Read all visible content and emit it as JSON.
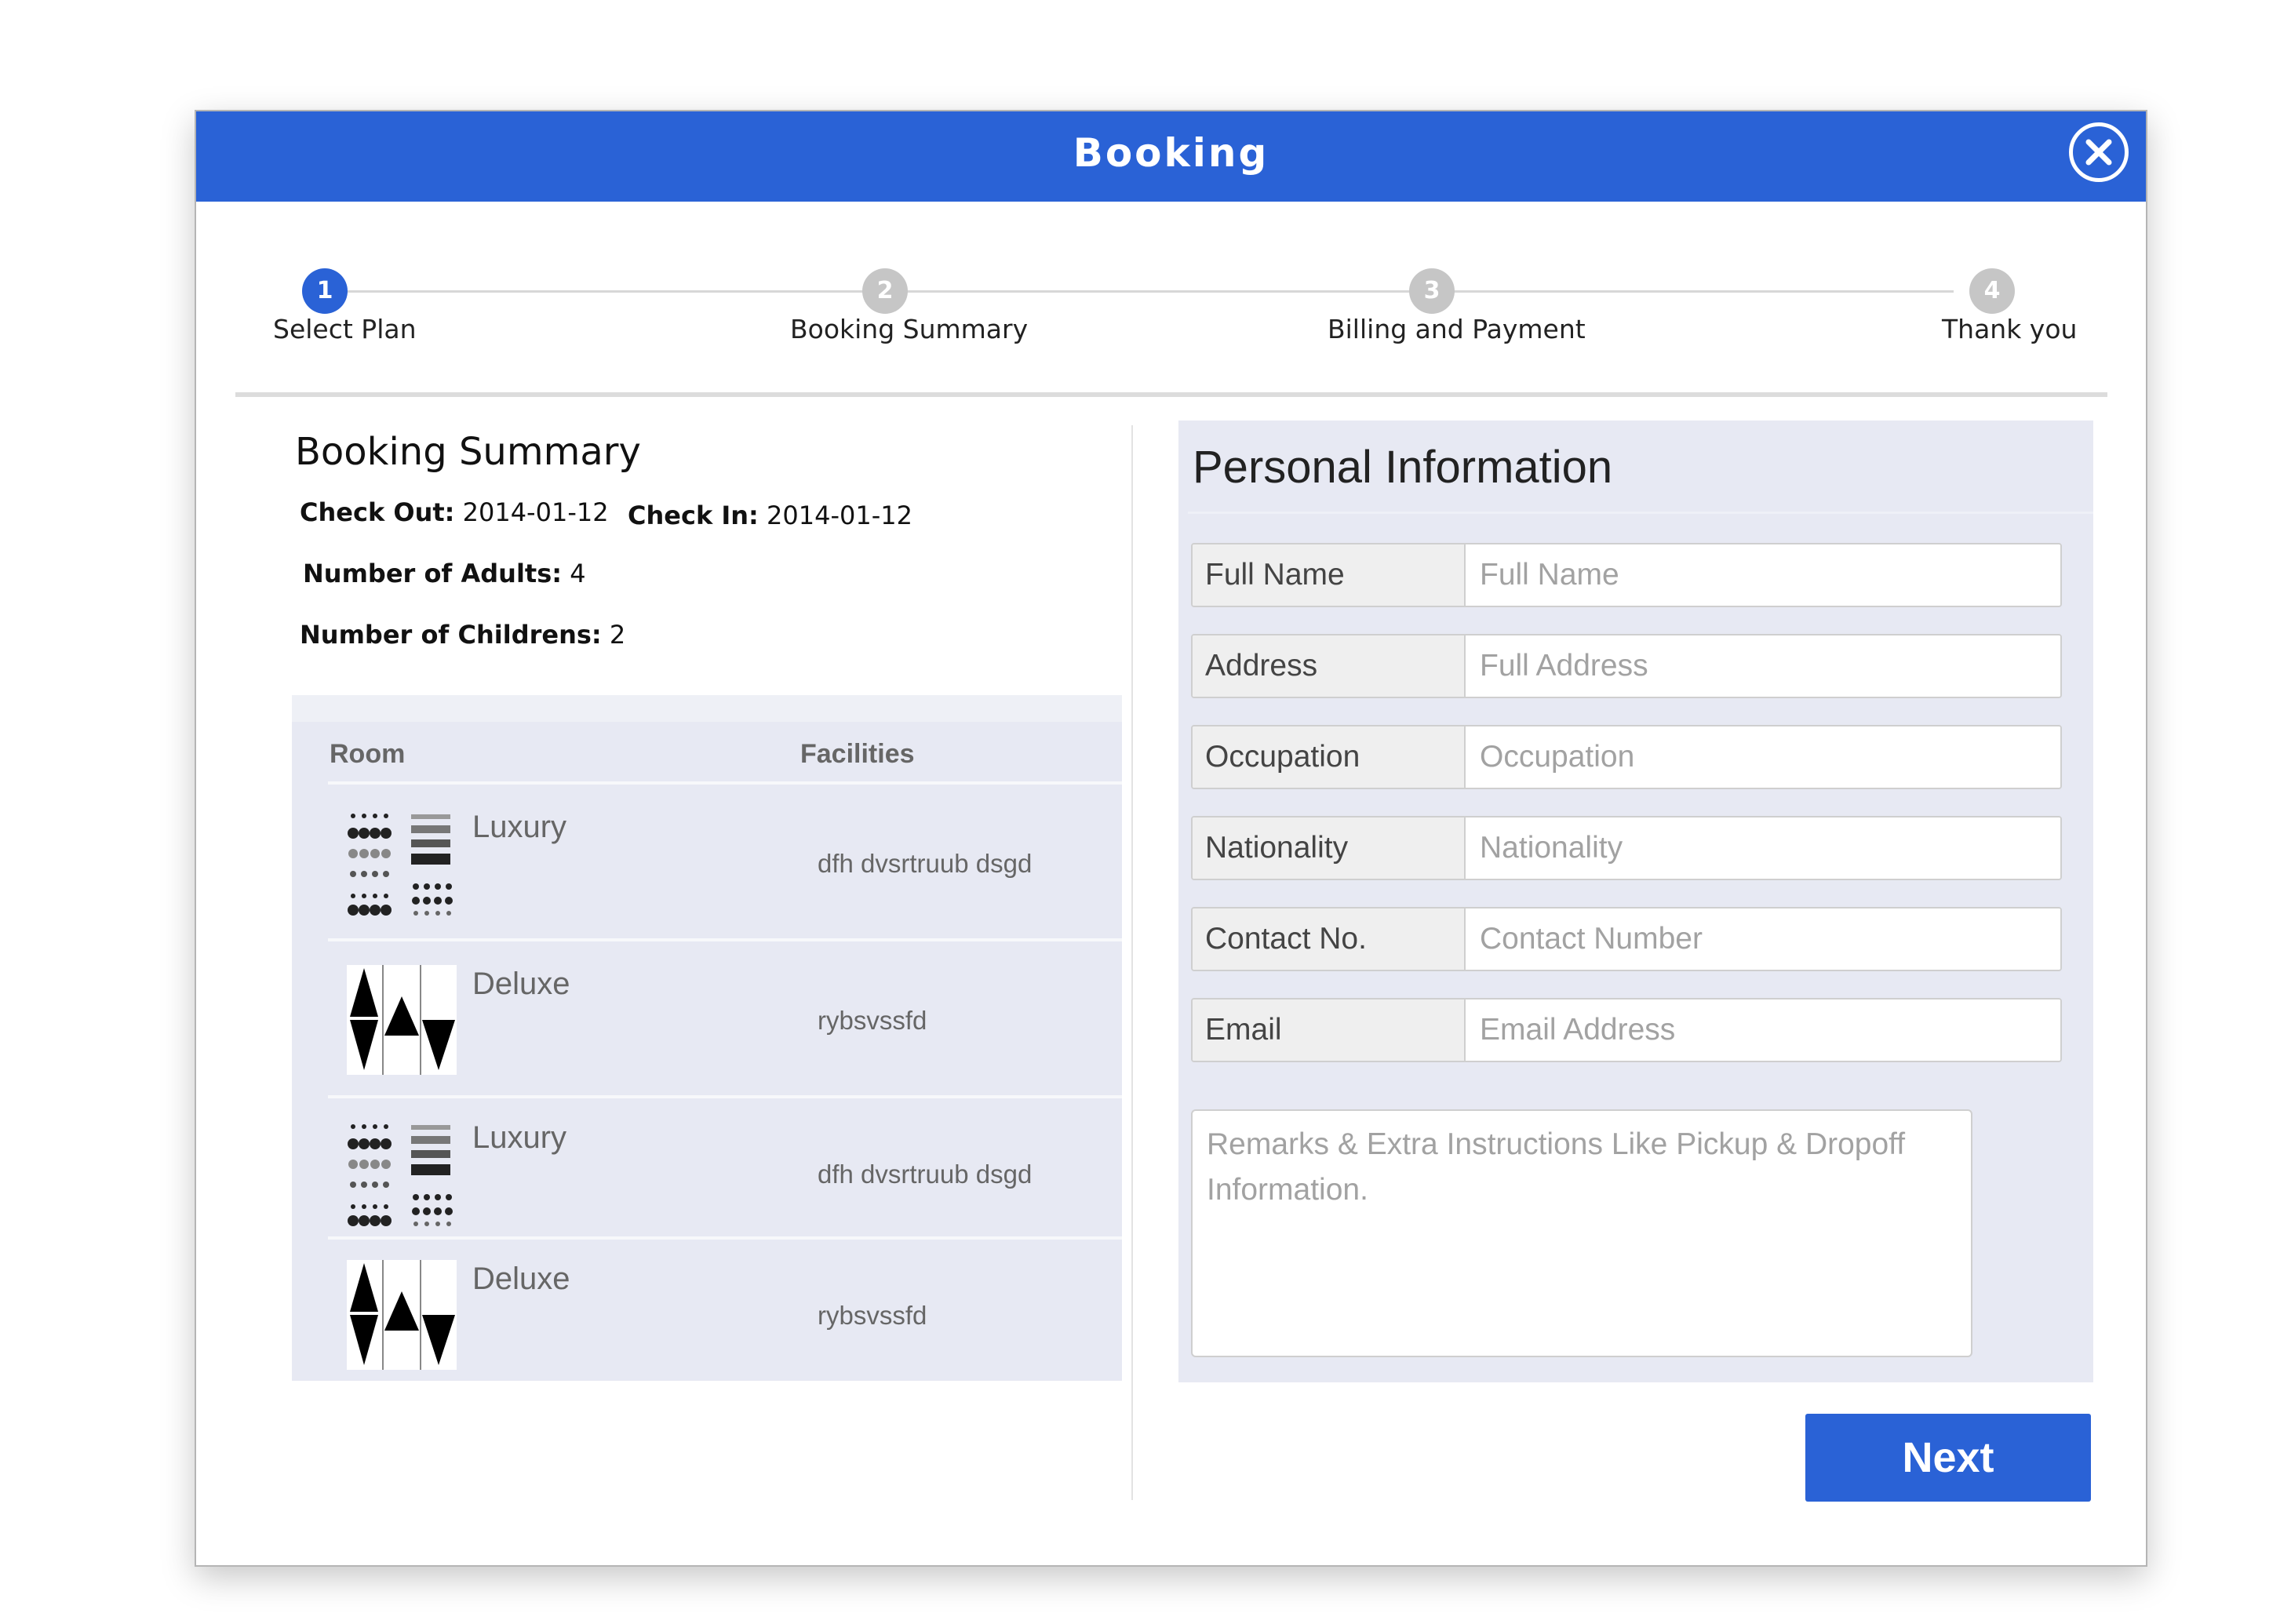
{
  "modal": {
    "title": "Booking",
    "close_icon": "close-circle-icon"
  },
  "stepper": {
    "steps": [
      {
        "number": "1",
        "label": "Select Plan",
        "active": true
      },
      {
        "number": "2",
        "label": "Booking Summary",
        "active": false
      },
      {
        "number": "3",
        "label": "Billing and Payment",
        "active": false
      },
      {
        "number": "4",
        "label": "Thank you",
        "active": false
      }
    ]
  },
  "summary": {
    "title": "Booking Summary",
    "check_out_label": "Check Out:",
    "check_out_value": "2014-01-12",
    "check_in_label": "Check In:",
    "check_in_value": "2014-01-12",
    "adults_label": "Number of Adults:",
    "adults_value": "4",
    "children_label": "Number of Childrens:",
    "children_value": "2"
  },
  "rooms": {
    "columns": [
      "Room",
      "Facilities"
    ],
    "rows": [
      {
        "name": "Luxury",
        "facilities": "dfh dvsrtruub dsgd",
        "thumb": "luxury-room-icon"
      },
      {
        "name": "Deluxe",
        "facilities": "rybsvssfd",
        "thumb": "deluxe-room-icon"
      },
      {
        "name": "Luxury",
        "facilities": "dfh dvsrtruub dsgd",
        "thumb": "luxury-room-icon"
      },
      {
        "name": "Deluxe",
        "facilities": "rybsvssfd",
        "thumb": "deluxe-room-icon"
      }
    ]
  },
  "personal": {
    "title": "Personal Information",
    "fields": [
      {
        "label": "Full Name",
        "placeholder": "Full Name",
        "value": ""
      },
      {
        "label": "Address",
        "placeholder": "Full Address",
        "value": ""
      },
      {
        "label": "Occupation",
        "placeholder": "Occupation",
        "value": ""
      },
      {
        "label": "Nationality",
        "placeholder": "Nationality",
        "value": ""
      },
      {
        "label": "Contact No.",
        "placeholder": "Contact Number",
        "value": ""
      },
      {
        "label": "Email",
        "placeholder": "Email Address",
        "value": ""
      }
    ],
    "remarks_placeholder": "Remarks & Extra Instructions Like Pickup & Dropoff Information."
  },
  "actions": {
    "next_label": "Next"
  },
  "colors": {
    "primary": "#2a62d6",
    "panel_bg": "#e7e9f3",
    "step_inactive": "#c6c6c6"
  }
}
